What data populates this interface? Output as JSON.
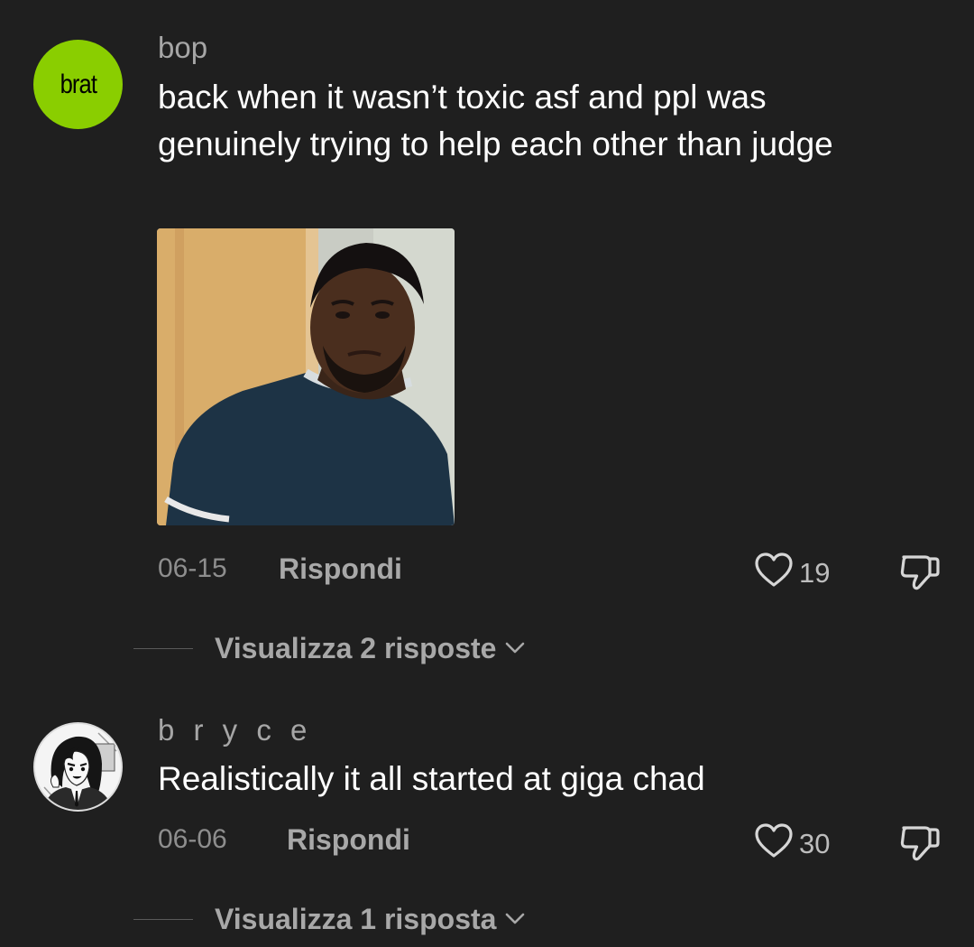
{
  "comments": [
    {
      "avatar_text": "brat",
      "username": "bop",
      "text": "back when it wasn’t toxic asf and ppl was genuinely trying to help each other than judge",
      "date": "06-15",
      "reply_label": "Rispondi",
      "likes": "19",
      "view_replies": "Visualizza 2 risposte"
    },
    {
      "username": "b r y c e",
      "text": "Realistically it all started at giga chad",
      "date": "06-06",
      "reply_label": "Rispondi",
      "likes": "30",
      "view_replies": "Visualizza 1 risposta"
    }
  ],
  "icons": {
    "like": "heart-outline-icon",
    "dislike": "thumbs-down-outline-icon",
    "expand": "chevron-down-icon"
  },
  "colors": {
    "background": "#1f1f1f",
    "brat_green": "#8ace00",
    "username": "#a6a6a6",
    "secondary_text": "#8e8e8e"
  }
}
